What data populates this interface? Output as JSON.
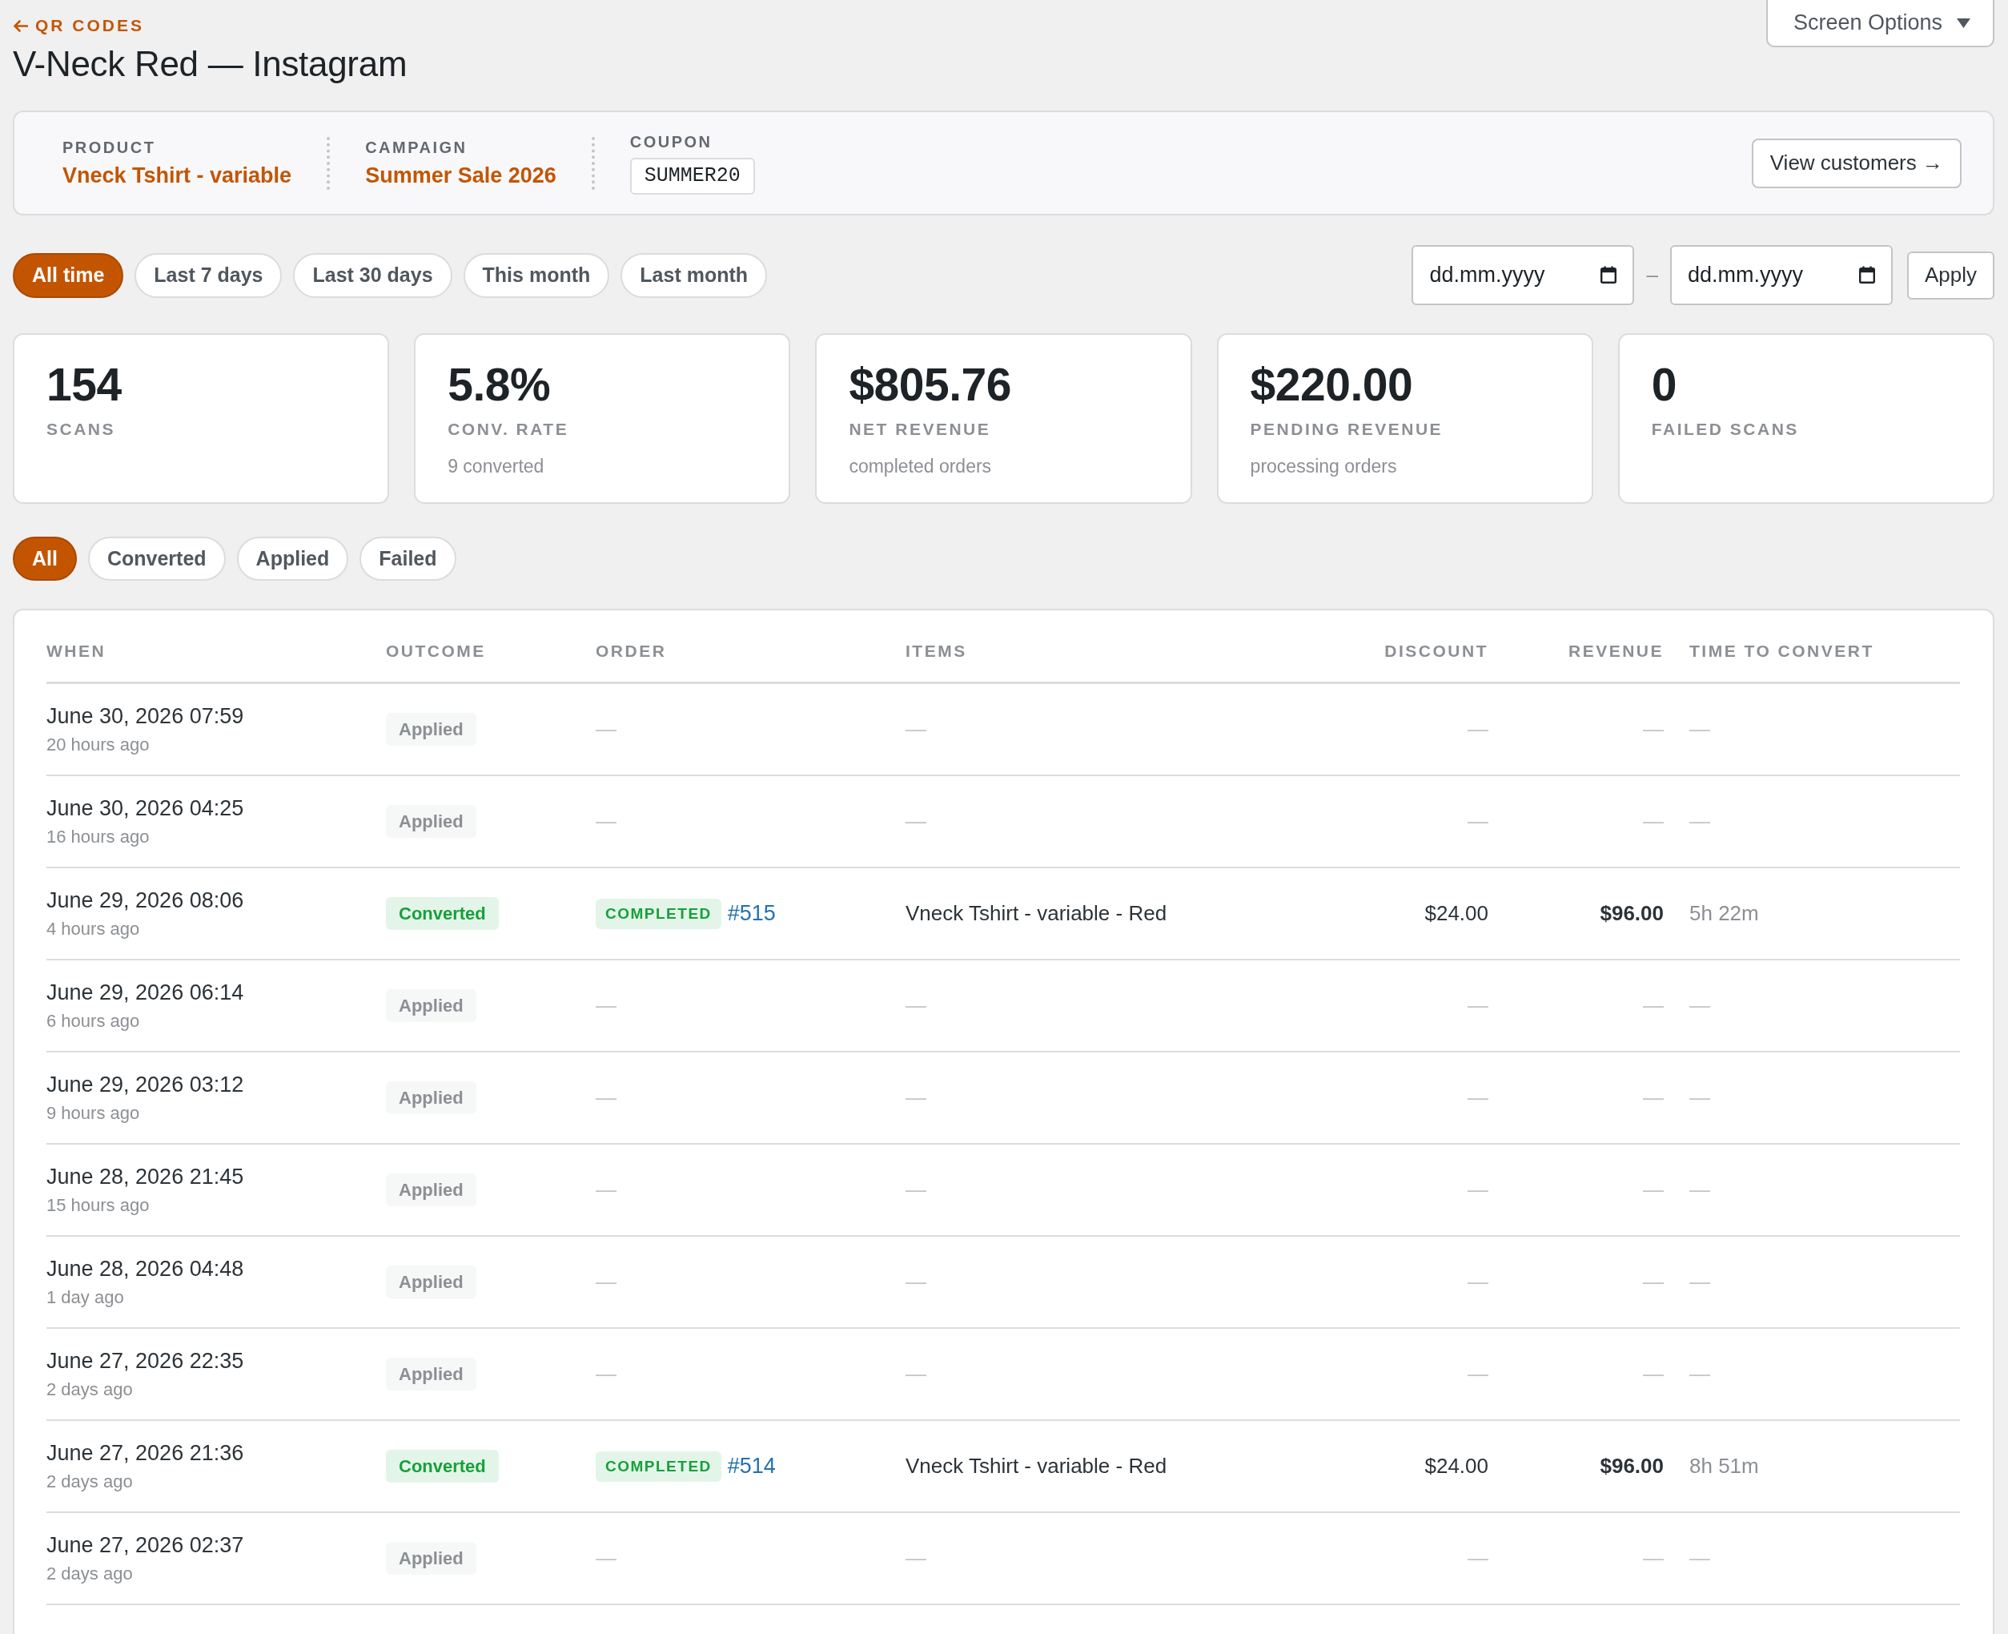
{
  "back_link": {
    "label": "QR CODES"
  },
  "title": "V-Neck Red — Instagram",
  "screen_options": {
    "label": "Screen Options"
  },
  "details": {
    "fields": [
      {
        "label": "PRODUCT",
        "value": "Vneck Tshirt - variable",
        "kind": "link"
      },
      {
        "label": "CAMPAIGN",
        "value": "Summer Sale 2026",
        "kind": "link"
      },
      {
        "label": "COUPON",
        "value": "SUMMER20",
        "kind": "code"
      }
    ],
    "action": "View customers →"
  },
  "date_presets": [
    {
      "label": "All time",
      "selected": true
    },
    {
      "label": "Last 7 days",
      "selected": false
    },
    {
      "label": "Last 30 days",
      "selected": false
    },
    {
      "label": "This month",
      "selected": false
    },
    {
      "label": "Last month",
      "selected": false
    }
  ],
  "date_range": {
    "from": {
      "placeholder": "dd.mm.yyyy"
    },
    "separator": "–",
    "to": {
      "placeholder": "dd.mm.yyyy"
    },
    "apply": "Apply"
  },
  "stats": [
    {
      "value": "154",
      "label": "SCANS"
    },
    {
      "value": "5.8%",
      "label": "CONV. RATE",
      "note": "9 converted"
    },
    {
      "value": "$805.76",
      "label": "NET REVENUE",
      "note": "completed orders"
    },
    {
      "value": "$220.00",
      "label": "PENDING REVENUE",
      "note": "processing orders"
    },
    {
      "value": "0",
      "label": "FAILED SCANS"
    }
  ],
  "outcome_filters": [
    {
      "label": "All",
      "selected": true
    },
    {
      "label": "Converted",
      "selected": false
    },
    {
      "label": "Applied",
      "selected": false
    },
    {
      "label": "Failed",
      "selected": false
    }
  ],
  "table": {
    "columns": [
      "WHEN",
      "OUTCOME",
      "ORDER",
      "ITEMS",
      "DISCOUNT",
      "REVENUE",
      "TIME TO CONVERT"
    ],
    "rows": [
      {
        "when": "June 30, 2026 07:59",
        "ago": "20 hours ago",
        "kind": "applied",
        "outcome": "Applied",
        "order": "—",
        "items": "—",
        "discount": "—",
        "revenue": "—",
        "time_to_convert": "—"
      },
      {
        "when": "June 30, 2026 04:25",
        "ago": "16 hours ago",
        "kind": "applied",
        "outcome": "Applied",
        "order": "—",
        "items": "—",
        "discount": "—",
        "revenue": "—",
        "time_to_convert": "—"
      },
      {
        "when": "June 29, 2026 08:06",
        "ago": "4 hours ago",
        "kind": "converted",
        "outcome": "Converted",
        "order": {
          "status": "COMPLETED",
          "number": "#515"
        },
        "items": "Vneck Tshirt - variable - Red",
        "discount": "$24.00",
        "revenue": "$96.00",
        "time_to_convert": "5h 22m"
      },
      {
        "when": "June 29, 2026 06:14",
        "ago": "6 hours ago",
        "kind": "applied",
        "outcome": "Applied",
        "order": "—",
        "items": "—",
        "discount": "—",
        "revenue": "—",
        "time_to_convert": "—"
      },
      {
        "when": "June 29, 2026 03:12",
        "ago": "9 hours ago",
        "kind": "applied",
        "outcome": "Applied",
        "order": "—",
        "items": "—",
        "discount": "—",
        "revenue": "—",
        "time_to_convert": "—"
      },
      {
        "when": "June 28, 2026 21:45",
        "ago": "15 hours ago",
        "kind": "applied",
        "outcome": "Applied",
        "order": "—",
        "items": "—",
        "discount": "—",
        "revenue": "—",
        "time_to_convert": "—"
      },
      {
        "when": "June 28, 2026 04:48",
        "ago": "1 day ago",
        "kind": "applied",
        "outcome": "Applied",
        "order": "—",
        "items": "—",
        "discount": "—",
        "revenue": "—",
        "time_to_convert": "—"
      },
      {
        "when": "June 27, 2026 22:35",
        "ago": "2 days ago",
        "kind": "applied",
        "outcome": "Applied",
        "order": "—",
        "items": "—",
        "discount": "—",
        "revenue": "—",
        "time_to_convert": "—"
      },
      {
        "when": "June 27, 2026 21:36",
        "ago": "2 days ago",
        "kind": "converted",
        "outcome": "Converted",
        "order": {
          "status": "COMPLETED",
          "number": "#514"
        },
        "items": "Vneck Tshirt - variable - Red",
        "discount": "$24.00",
        "revenue": "$96.00",
        "time_to_convert": "8h 51m"
      },
      {
        "when": "June 27, 2026 02:37",
        "ago": "2 days ago",
        "kind": "applied",
        "outcome": "Applied",
        "order": "—",
        "items": "—",
        "discount": "—",
        "revenue": "—",
        "time_to_convert": "—"
      }
    ]
  }
}
